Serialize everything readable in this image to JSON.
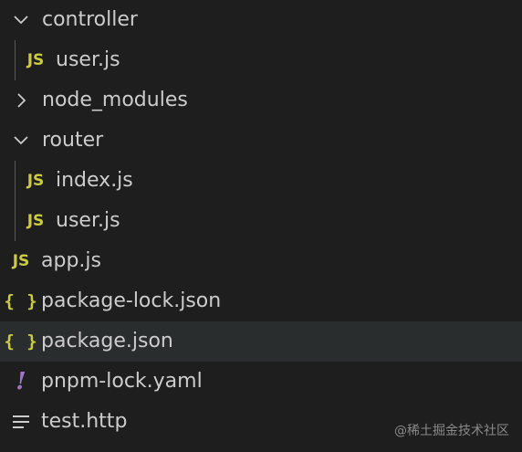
{
  "tree": [
    {
      "label": "controller",
      "kind": "folder",
      "expanded": true,
      "level": 0
    },
    {
      "label": "user.js",
      "kind": "js",
      "icon_text": "JS",
      "level": 1
    },
    {
      "label": "node_modules",
      "kind": "folder",
      "expanded": false,
      "level": 0
    },
    {
      "label": "router",
      "kind": "folder",
      "expanded": true,
      "level": 0
    },
    {
      "label": "index.js",
      "kind": "js",
      "icon_text": "JS",
      "level": 1
    },
    {
      "label": "user.js",
      "kind": "js",
      "icon_text": "JS",
      "level": 1
    },
    {
      "label": "app.js",
      "kind": "js",
      "icon_text": "JS",
      "level": 0
    },
    {
      "label": "package-lock.json",
      "kind": "json",
      "icon_text": "{ }",
      "level": 0
    },
    {
      "label": "package.json",
      "kind": "json",
      "icon_text": "{ }",
      "level": 0,
      "selected": true
    },
    {
      "label": "pnpm-lock.yaml",
      "kind": "yaml",
      "icon_text": "!",
      "level": 0
    },
    {
      "label": "test.http",
      "kind": "text",
      "level": 0
    }
  ],
  "watermark": "@稀土掘金技术社区",
  "colors": {
    "background": "#1e1e1e",
    "selected_row": "#2a2d2e",
    "js_icon": "#cbcb41",
    "json_icon": "#cbcb41",
    "yaml_icon": "#a074c4",
    "text": "#cccccc"
  }
}
